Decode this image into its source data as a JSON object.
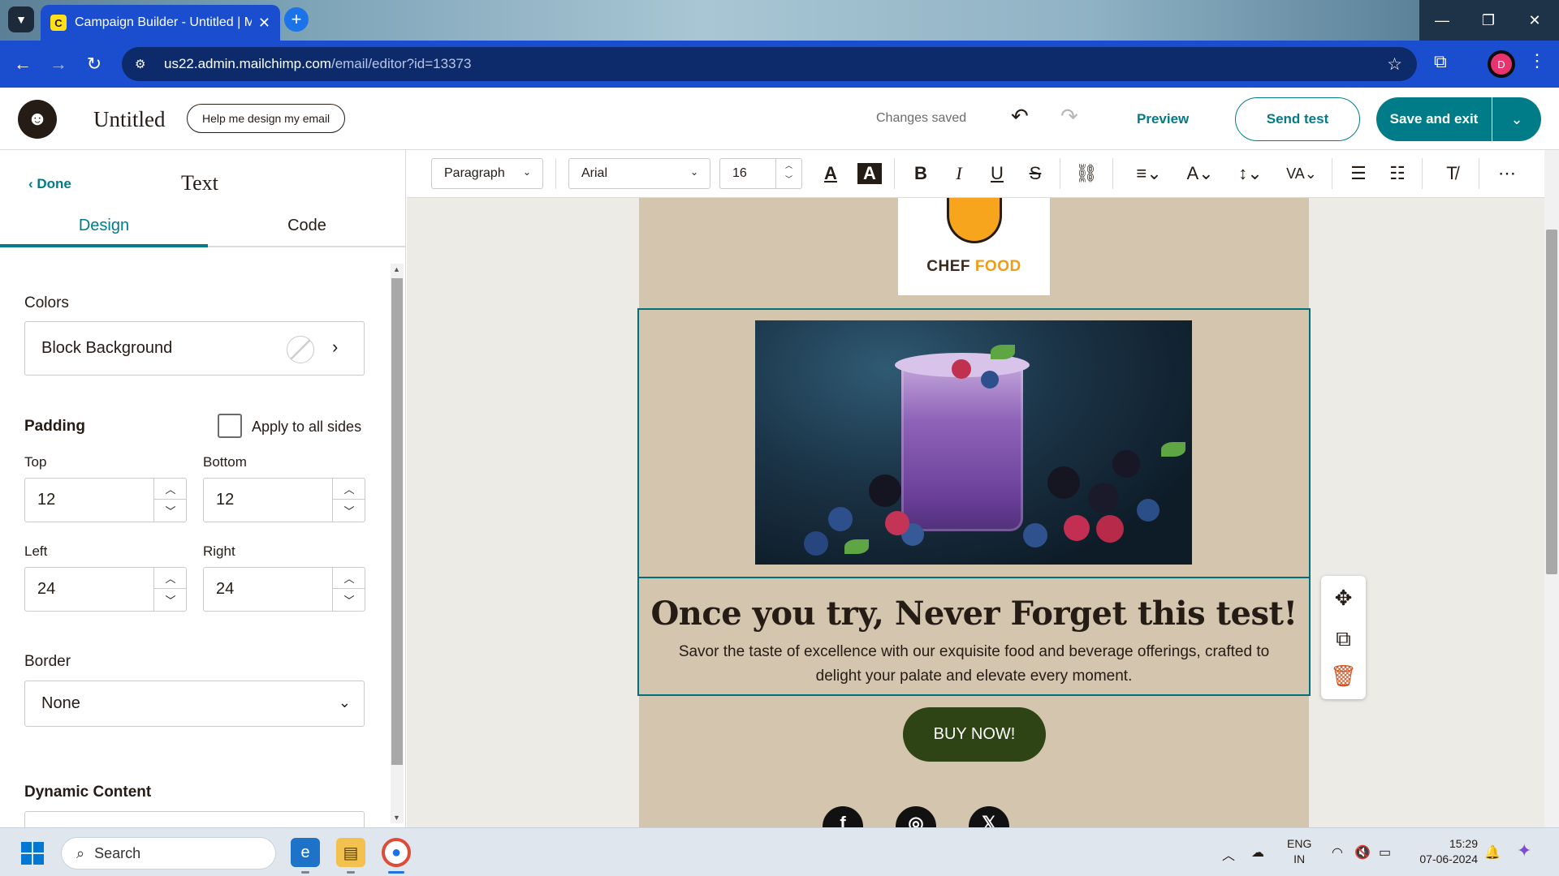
{
  "browser": {
    "tab_title": "Campaign Builder - Untitled | M",
    "url_host": "us22.admin.mailchimp.com",
    "url_path": "/email/editor?id=13373",
    "profile_initial": "D"
  },
  "header": {
    "doc_title": "Untitled",
    "help_button": "Help me design my email",
    "status": "Changes saved",
    "preview": "Preview",
    "send_test": "Send test",
    "save_exit": "Save and exit"
  },
  "panel": {
    "done": "Done",
    "title": "Text",
    "tabs": [
      "Design",
      "Code"
    ],
    "colors_label": "Colors",
    "block_background": "Block Background",
    "padding_label": "Padding",
    "apply_all": "Apply to all sides",
    "padding": {
      "top_label": "Top",
      "top": "12",
      "bottom_label": "Bottom",
      "bottom": "12",
      "left_label": "Left",
      "left": "24",
      "right_label": "Right",
      "right": "24"
    },
    "border_label": "Border",
    "border_value": "None",
    "dynamic_label": "Dynamic Content"
  },
  "toolbar": {
    "block_type": "Paragraph",
    "font": "Arial",
    "font_size": "16"
  },
  "email": {
    "logo_chef": "CHEF",
    "logo_food": "FOOD",
    "headline": "Once you try, Never Forget this test!",
    "body": "Savor the taste of excellence with our exquisite food and beverage offerings, crafted to delight your palate and elevate every moment.",
    "button": "BUY NOW!",
    "social_icons": [
      "facebook-icon",
      "instagram-icon",
      "x-icon"
    ]
  },
  "taskbar": {
    "search": "Search",
    "lang_top": "ENG",
    "lang_bottom": "IN",
    "time": "15:29",
    "date": "07-06-2024"
  },
  "colors": {
    "brand": "#007c89",
    "email_bg": "#d3c5ae",
    "button_bg": "#2e4414",
    "browser_blue": "#1a4ecf"
  }
}
